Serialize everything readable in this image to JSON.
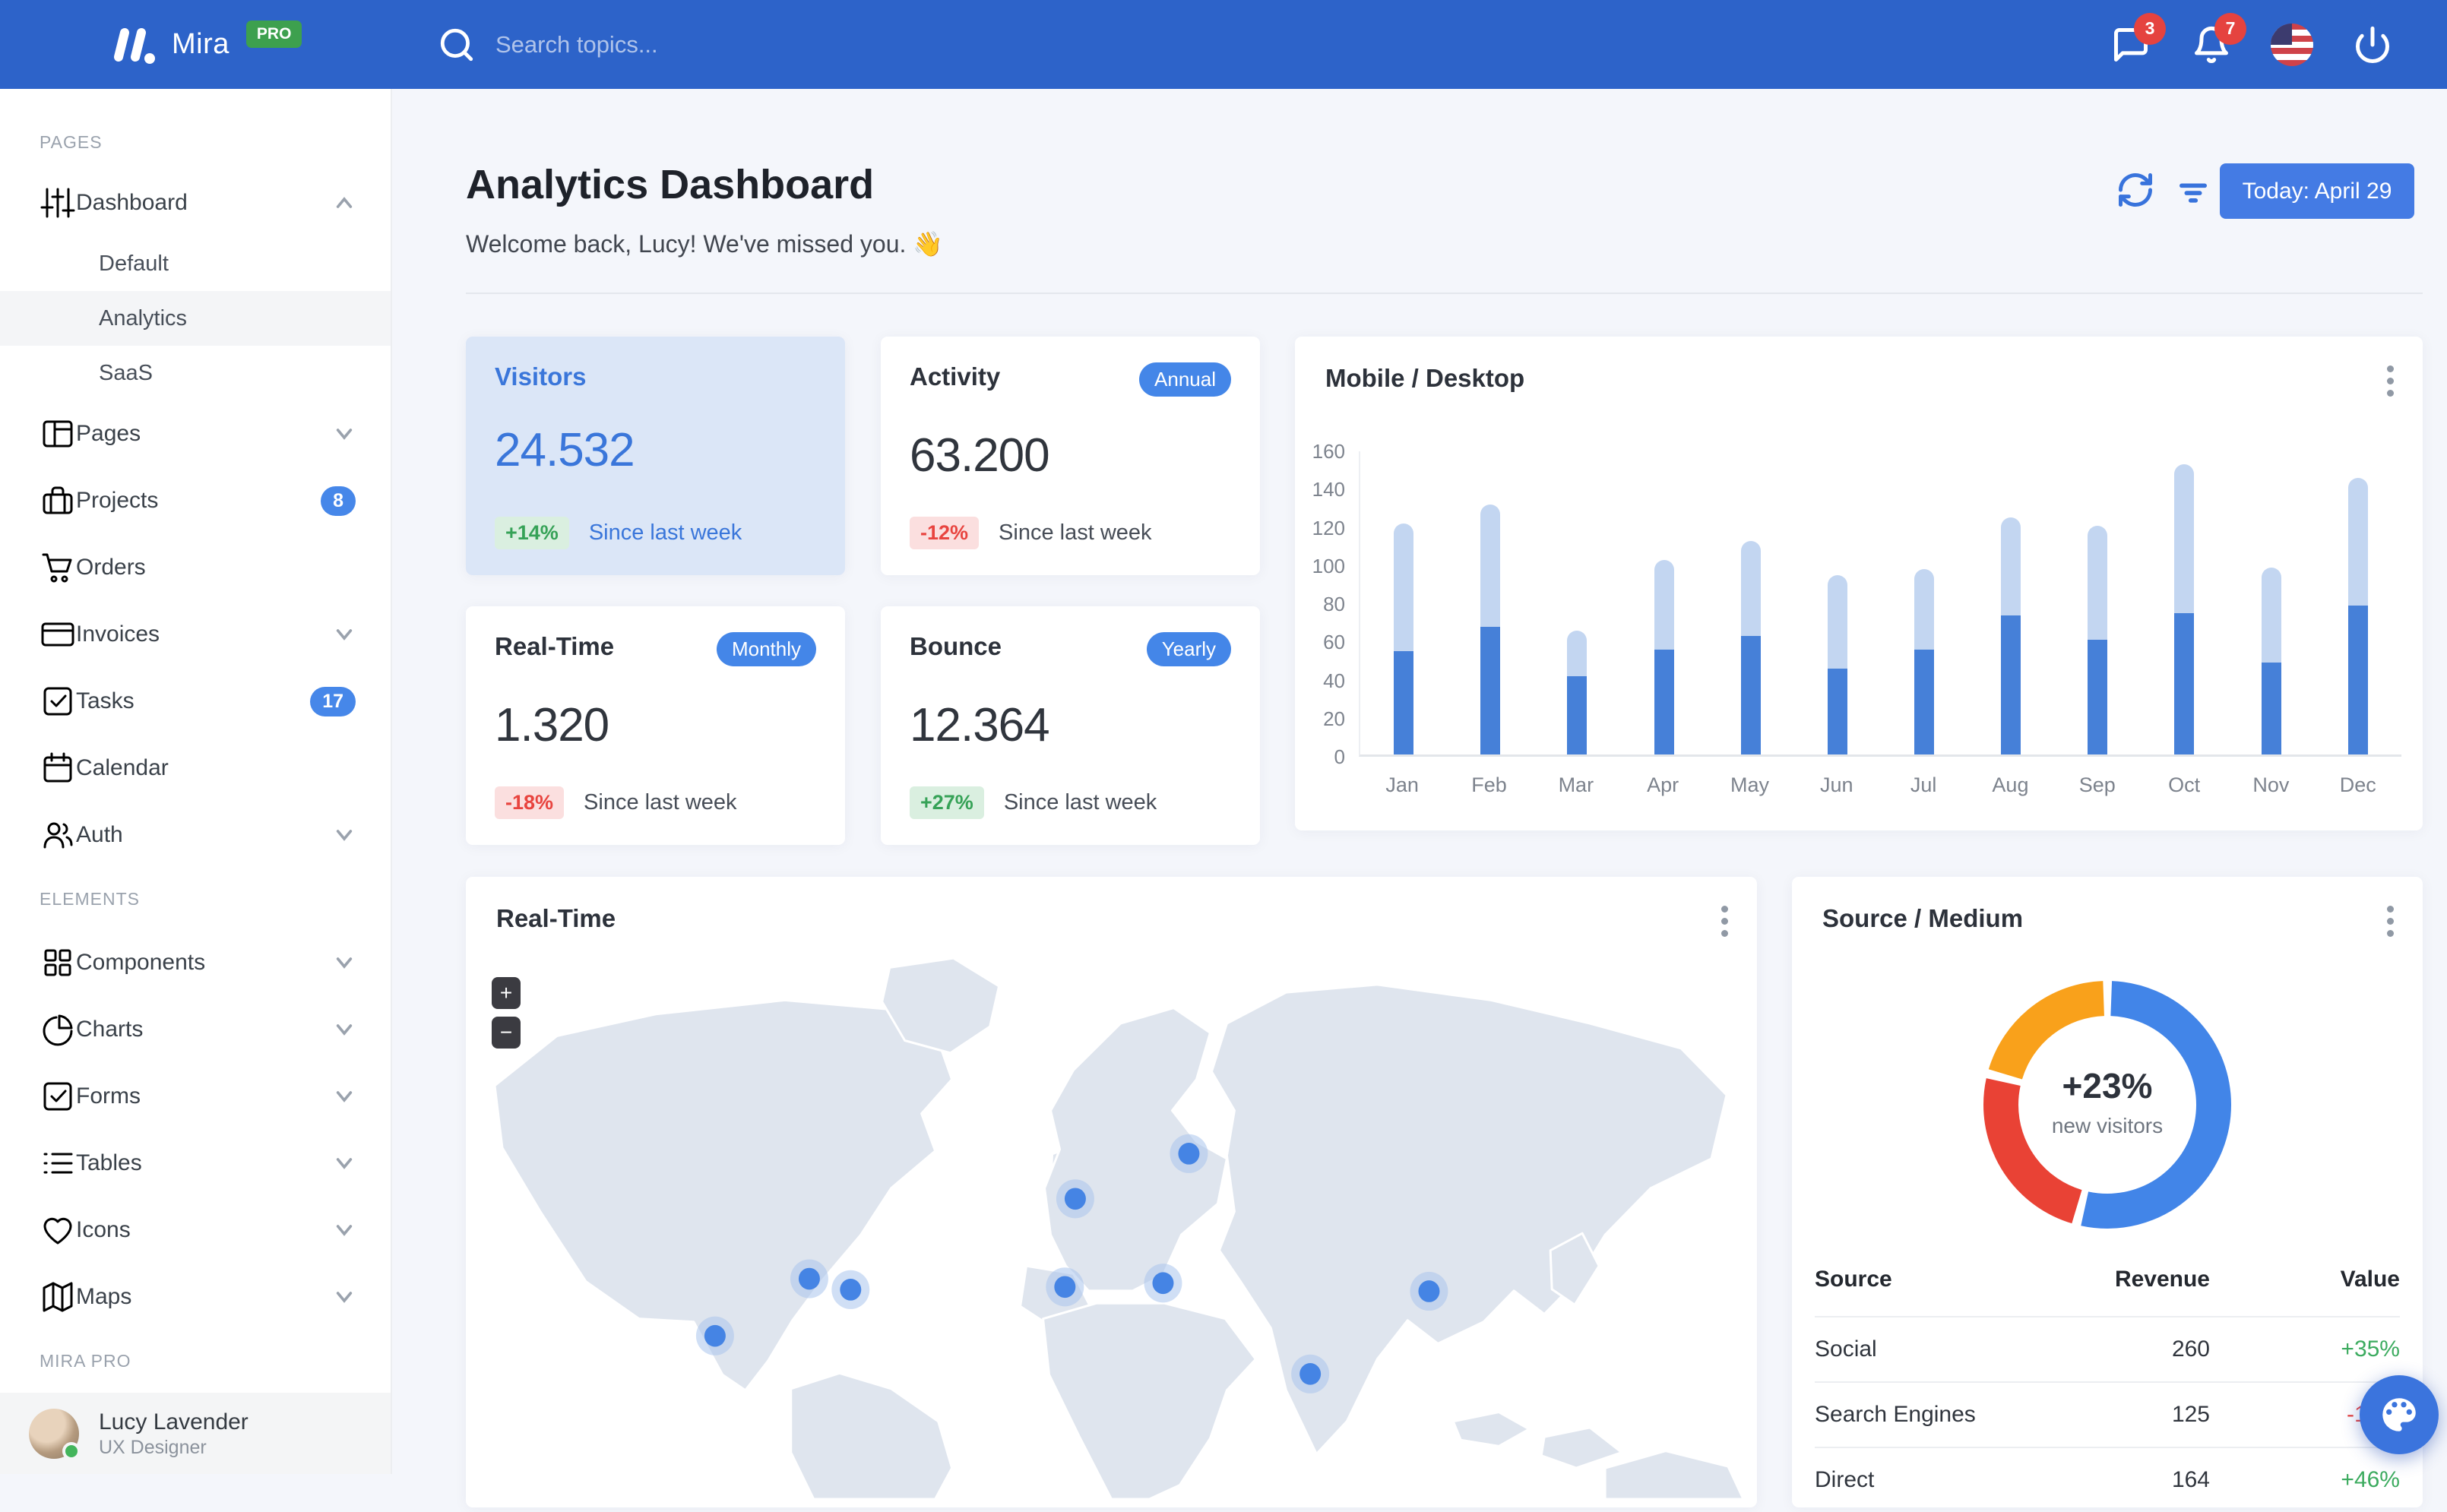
{
  "navbar": {
    "brand": "Mira",
    "brand_badge": "PRO",
    "search_placeholder": "Search topics...",
    "messages_badge": "3",
    "alerts_badge": "7"
  },
  "sidebar": {
    "sections": [
      {
        "label": "PAGES",
        "items": [
          {
            "icon": "sliders-icon",
            "label": "Dashboard",
            "chevron": "up",
            "children": [
              {
                "label": "Default",
                "active": false
              },
              {
                "label": "Analytics",
                "active": true
              },
              {
                "label": "SaaS",
                "active": false
              }
            ]
          },
          {
            "icon": "layout-icon",
            "label": "Pages",
            "chevron": "down"
          },
          {
            "icon": "briefcase-icon",
            "label": "Projects",
            "badge": "8"
          },
          {
            "icon": "cart-icon",
            "label": "Orders"
          },
          {
            "icon": "credit-card-icon",
            "label": "Invoices",
            "chevron": "down"
          },
          {
            "icon": "check-square-icon",
            "label": "Tasks",
            "badge": "17"
          },
          {
            "icon": "calendar-icon",
            "label": "Calendar"
          },
          {
            "icon": "users-icon",
            "label": "Auth",
            "chevron": "down"
          }
        ]
      },
      {
        "label": "ELEMENTS",
        "items": [
          {
            "icon": "grid-icon",
            "label": "Components",
            "chevron": "down"
          },
          {
            "icon": "pie-chart-icon",
            "label": "Charts",
            "chevron": "down"
          },
          {
            "icon": "check-square-icon",
            "label": "Forms",
            "chevron": "down"
          },
          {
            "icon": "list-icon",
            "label": "Tables",
            "chevron": "down"
          },
          {
            "icon": "heart-icon",
            "label": "Icons",
            "chevron": "down"
          },
          {
            "icon": "map-icon",
            "label": "Maps",
            "chevron": "down"
          }
        ]
      },
      {
        "label": "MIRA PRO",
        "items": []
      }
    ],
    "user": {
      "name": "Lucy Lavender",
      "role": "UX Designer"
    }
  },
  "header": {
    "title": "Analytics Dashboard",
    "subtitle": "Welcome back, Lucy! We've missed you. 👋",
    "date_button": "Today: April 29"
  },
  "stat_cards": [
    {
      "title": "Visitors",
      "value": "24.532",
      "delta": "+14%",
      "delta_dir": "up",
      "note": "Since last week",
      "highlight": true
    },
    {
      "title": "Activity",
      "badge": "Annual",
      "value": "63.200",
      "delta": "-12%",
      "delta_dir": "down",
      "note": "Since last week"
    },
    {
      "title": "Real-Time",
      "badge": "Monthly",
      "value": "1.320",
      "delta": "-18%",
      "delta_dir": "down",
      "note": "Since last week"
    },
    {
      "title": "Bounce",
      "badge": "Yearly",
      "value": "12.364",
      "delta": "+27%",
      "delta_dir": "up",
      "note": "Since last week"
    }
  ],
  "map_card": {
    "title": "Real-Time",
    "zoom_in": "+",
    "zoom_out": "−",
    "markers": [
      {
        "x": 19.3,
        "y": 70.0
      },
      {
        "x": 26.6,
        "y": 59.5
      },
      {
        "x": 29.8,
        "y": 61.5
      },
      {
        "x": 47.2,
        "y": 44.8
      },
      {
        "x": 46.4,
        "y": 61.0
      },
      {
        "x": 56.0,
        "y": 36.5
      },
      {
        "x": 54.0,
        "y": 60.3
      },
      {
        "x": 65.4,
        "y": 77.0
      },
      {
        "x": 74.6,
        "y": 61.8
      }
    ]
  },
  "source_card": {
    "title": "Source / Medium"
  },
  "chart_data": [
    {
      "type": "bar",
      "title": "Mobile / Desktop",
      "stacked": true,
      "categories": [
        "Jan",
        "Feb",
        "Mar",
        "Apr",
        "May",
        "Jun",
        "Jul",
        "Aug",
        "Sep",
        "Oct",
        "Nov",
        "Dec"
      ],
      "series": [
        {
          "name": "Mobile",
          "color": "#c3d6f1",
          "values": [
            67,
            64,
            24,
            47,
            50,
            49,
            42,
            51,
            60,
            78,
            50,
            67
          ]
        },
        {
          "name": "Desktop",
          "color": "#4680d8",
          "values": [
            54,
            67,
            41,
            55,
            62,
            45,
            55,
            73,
            60,
            74,
            48,
            78
          ]
        }
      ],
      "ylim": [
        0,
        160
      ],
      "yticks": [
        0,
        20,
        40,
        60,
        80,
        100,
        120,
        140,
        160
      ],
      "xlabel": "",
      "ylabel": "",
      "legend": false
    },
    {
      "type": "donut",
      "title": "Source / Medium",
      "center_label": "+23%",
      "center_sublabel": "new visitors",
      "slices": [
        {
          "label": "blue segment",
          "value": 54,
          "color": "#4285e8"
        },
        {
          "label": "red segment",
          "value": 25,
          "color": "#e94235"
        },
        {
          "label": "orange segment",
          "value": 21,
          "color": "#f9a11b"
        }
      ]
    },
    {
      "type": "table",
      "title": "Source / Medium",
      "headers": [
        "Source",
        "Revenue",
        "Value"
      ],
      "rows": [
        [
          "Social",
          "260",
          "+35%"
        ],
        [
          "Search Engines",
          "125",
          "-12%"
        ],
        [
          "Direct",
          "164",
          "+46%"
        ]
      ]
    }
  ],
  "colors": {
    "navbar": "#2d63c9",
    "accent": "#4285e8",
    "positive": "#3cab5f",
    "negative": "#e8443f",
    "bar_desktop": "#4680d8",
    "bar_mobile": "#c3d6f1",
    "map_land": "#dfe5ee",
    "marker": "#4584e4"
  }
}
